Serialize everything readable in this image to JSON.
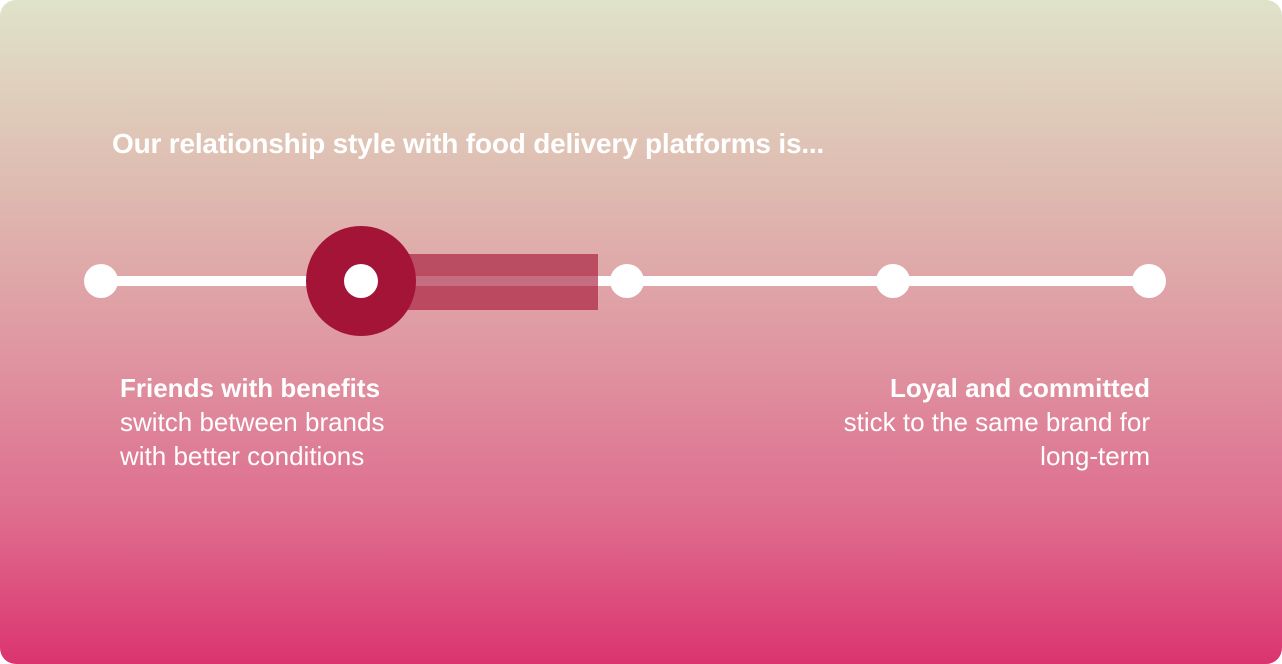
{
  "question": "Our relationship style with food delivery platforms is...",
  "scale": {
    "steps": 5,
    "selected_value": 1.5,
    "min_value": 0,
    "max_value": 4
  },
  "left_pole": {
    "title": "Friends with benefits",
    "description": "switch between brands with better conditions"
  },
  "right_pole": {
    "title": "Loyal and committed",
    "description": "stick to the same brand for long-term"
  },
  "colors": {
    "accent": "#a31437",
    "track": "#ffffff",
    "gradient_top": "#dfe3c9",
    "gradient_bottom": "#db346f"
  },
  "icons": [
    "slider-handle-icon"
  ]
}
